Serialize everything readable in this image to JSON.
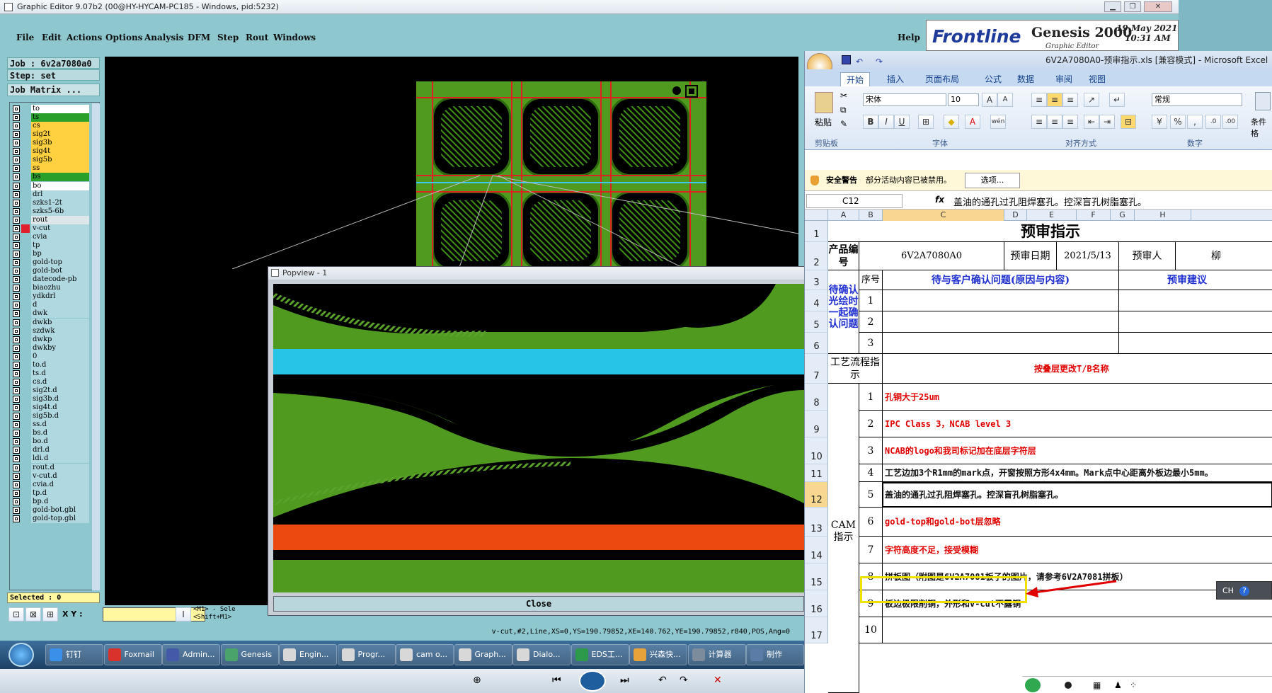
{
  "genesis": {
    "title": "Graphic Editor 9.07b2 (00@HY-HYCAM-PC185 - Windows, pid:5232)",
    "menu": [
      "File",
      "Edit",
      "Actions",
      "Options",
      "Analysis",
      "DFM",
      "Step",
      "Rout",
      "Windows"
    ],
    "help": "Help",
    "brand": {
      "logo": "Frontline",
      "product": "Genesis 2000",
      "sub": "Graphic Editor",
      "date_line1": "19 May 2021",
      "date_line2": "10:31 AM"
    },
    "job": "Job : 6v2a7080a0",
    "step": "Step: set",
    "job_matrix": "Job Matrix ...",
    "layers": [
      {
        "name": "to",
        "color": "#ffffff"
      },
      {
        "name": "ts",
        "color": "#2aa02a"
      },
      {
        "name": "cs",
        "color": "#ffd040"
      },
      {
        "name": "sig2t",
        "color": "#ffd040"
      },
      {
        "name": "sig3b",
        "color": "#ffd040"
      },
      {
        "name": "sig4t",
        "color": "#ffd040"
      },
      {
        "name": "sig5b",
        "color": "#ffd040"
      },
      {
        "name": "ss",
        "color": "#ffd040"
      },
      {
        "name": "bs",
        "color": "#2aa02a"
      },
      {
        "name": "bo",
        "color": "#ffffff"
      },
      {
        "name": "drl",
        "color": "#b0d8e0"
      },
      {
        "name": "szks1-2t",
        "color": "#b0d8e0"
      },
      {
        "name": "szks5-6b",
        "color": "#b0d8e0"
      },
      {
        "name": "rout",
        "color": "#dde6e8"
      },
      {
        "name": "v-cut",
        "color": "#b0d8e0",
        "swatch": "#e0202a"
      },
      {
        "name": "cvia",
        "color": "#b0d8e0"
      },
      {
        "name": "tp",
        "color": "#b0d8e0"
      },
      {
        "name": "bp",
        "color": "#b0d8e0"
      },
      {
        "name": "gold-top",
        "color": "#b0d8e0"
      },
      {
        "name": "gold-bot",
        "color": "#b0d8e0"
      },
      {
        "name": "datecode-pb",
        "color": "#b0d8e0"
      },
      {
        "name": "biaozhu",
        "color": "#b0d8e0"
      },
      {
        "name": "ydkdrl",
        "color": "#b0d8e0"
      },
      {
        "name": "d",
        "color": "#b0d8e0"
      },
      {
        "name": "dwk",
        "color": "#b0d8e0"
      },
      {
        "name": "dwkb",
        "color": "#b0d8e0"
      },
      {
        "name": "szdwk",
        "color": "#b0d8e0"
      },
      {
        "name": "dwkp",
        "color": "#b0d8e0"
      },
      {
        "name": "dwkby",
        "color": "#b0d8e0"
      },
      {
        "name": "0",
        "color": "#b0d8e0"
      },
      {
        "name": "to.d",
        "color": "#b0d8e0"
      },
      {
        "name": "ts.d",
        "color": "#b0d8e0"
      },
      {
        "name": "cs.d",
        "color": "#b0d8e0"
      },
      {
        "name": "sig2t.d",
        "color": "#b0d8e0"
      },
      {
        "name": "sig3b.d",
        "color": "#b0d8e0"
      },
      {
        "name": "sig4t.d",
        "color": "#b0d8e0"
      },
      {
        "name": "sig5b.d",
        "color": "#b0d8e0"
      },
      {
        "name": "ss.d",
        "color": "#b0d8e0"
      },
      {
        "name": "bs.d",
        "color": "#b0d8e0"
      },
      {
        "name": "bo.d",
        "color": "#b0d8e0"
      },
      {
        "name": "drl.d",
        "color": "#b0d8e0"
      },
      {
        "name": "ldi.d",
        "color": "#b0d8e0"
      },
      {
        "name": "rout.d",
        "color": "#b0d8e0"
      },
      {
        "name": "v-cut.d",
        "color": "#b0d8e0"
      },
      {
        "name": "cvia.d",
        "color": "#b0d8e0"
      },
      {
        "name": "tp.d",
        "color": "#b0d8e0"
      },
      {
        "name": "bp.d",
        "color": "#b0d8e0"
      },
      {
        "name": "gold-bot.gbl",
        "color": "#b0d8e0"
      },
      {
        "name": "gold-top.gbl",
        "color": "#b0d8e0"
      }
    ],
    "selected": "Selected : 0",
    "xy_label": "X Y :",
    "mouse_hint": "<M1> - Sele",
    "mouse_hint2": "<Shift+M1>",
    "status": "v-cut,#2,Line,XS=0,YS=190.79852,XE=140.762,YE=190.79852,r840,POS,Ang=0",
    "popview": {
      "title": "Popview - 1",
      "close": "Close"
    }
  },
  "taskbar": {
    "items": [
      {
        "label": "钉钉",
        "color": "#3a8fe6"
      },
      {
        "label": "Foxmail",
        "color": "#d8322a"
      },
      {
        "label": "Admin...",
        "color": "#445aa8"
      },
      {
        "label": "Genesis",
        "color": "#4aa36a"
      },
      {
        "label": "Engin...",
        "color": "#d8d8d8"
      },
      {
        "label": "Progr...",
        "color": "#d8d8d8"
      },
      {
        "label": "cam o...",
        "color": "#d8d8d8"
      },
      {
        "label": "Graph...",
        "color": "#d8d8d8"
      },
      {
        "label": "Dialo...",
        "color": "#d8d8d8"
      },
      {
        "label": "EDS工...",
        "color": "#2c9a4a"
      },
      {
        "label": "兴森快...",
        "color": "#e8a23a"
      },
      {
        "label": "计算器",
        "color": "#7c8c9c"
      },
      {
        "label": "制作",
        "color": "#5c7ca8"
      }
    ]
  },
  "excel": {
    "title": "6V2A7080A0-预审指示.xls  [兼容模式] - Microsoft Excel",
    "tabs": [
      "开始",
      "插入",
      "页面布局",
      "公式",
      "数据",
      "审阅",
      "视图"
    ],
    "font_name": "宋体",
    "font_size": "10",
    "number_format": "常规",
    "groups": [
      "剪贴板",
      "字体",
      "对齐方式",
      "数字"
    ],
    "paste": "粘贴",
    "cond_format": "条件格",
    "security_label": "安全警告",
    "security_msg": "部分活动内容已被禁用。",
    "options_btn": "选项...",
    "name_box": "C12",
    "fx": "fx",
    "formula": "盖油的通孔过孔阻焊塞孔。控深盲孔树脂塞孔。",
    "columns": [
      "A",
      "B",
      "C",
      "D",
      "E",
      "F",
      "G",
      "H"
    ],
    "rows": [
      "1",
      "2",
      "3",
      "4",
      "5",
      "6",
      "7",
      "8",
      "9",
      "10",
      "11",
      "12",
      "13",
      "14",
      "15",
      "16",
      "17"
    ],
    "sheet": {
      "title": "预审指示",
      "product_label": "产品编号",
      "product_value": "6V2A7080A0",
      "review_date_label": "预审日期",
      "review_date_value": "2021/5/13",
      "reviewer_label": "预审人",
      "reviewer_value": "柳",
      "confirm_label": "待确认光绘时一起确认问题",
      "seq_label": "序号",
      "issue_header": "待与客户确认问题(原因与内容)",
      "suggest_header": "预审建议",
      "confirm_rows": [
        "1",
        "2",
        "3"
      ],
      "process_label": "工艺流程指示",
      "process_value": "按叠层更改T/B名称",
      "cam_label": "CAM指示",
      "cam_items": [
        {
          "n": "1",
          "text": "孔铜大于25um",
          "red": true
        },
        {
          "n": "2",
          "text": "IPC Class 3，NCAB level 3",
          "red": true
        },
        {
          "n": "3",
          "text": "NCAB的logo和我司标记加在底层字符层",
          "red": true
        },
        {
          "n": "4",
          "text": "工艺边加3个R1mm的mark点，开窗按照方形4x4mm。Mark点中心距离外板边最小5mm。",
          "red": false
        },
        {
          "n": "5",
          "text": "盖油的通孔过孔阻焊塞孔。控深盲孔树脂塞孔。",
          "red": false
        },
        {
          "n": "6",
          "text": "gold-top和gold-bot层忽略",
          "red": true
        },
        {
          "n": "7",
          "text": "字符高度不足，接受模糊",
          "red": true
        },
        {
          "n": "8",
          "text": "拼板图（附图是6V2A7081板子的图片，请参考6V2A7081拼板）",
          "red": false
        },
        {
          "n": "9",
          "text": "板边极限削铜，外形和v-cut不露铜",
          "red": false
        },
        {
          "n": "10",
          "text": "",
          "red": false
        }
      ]
    },
    "ch_badge": "CH"
  }
}
